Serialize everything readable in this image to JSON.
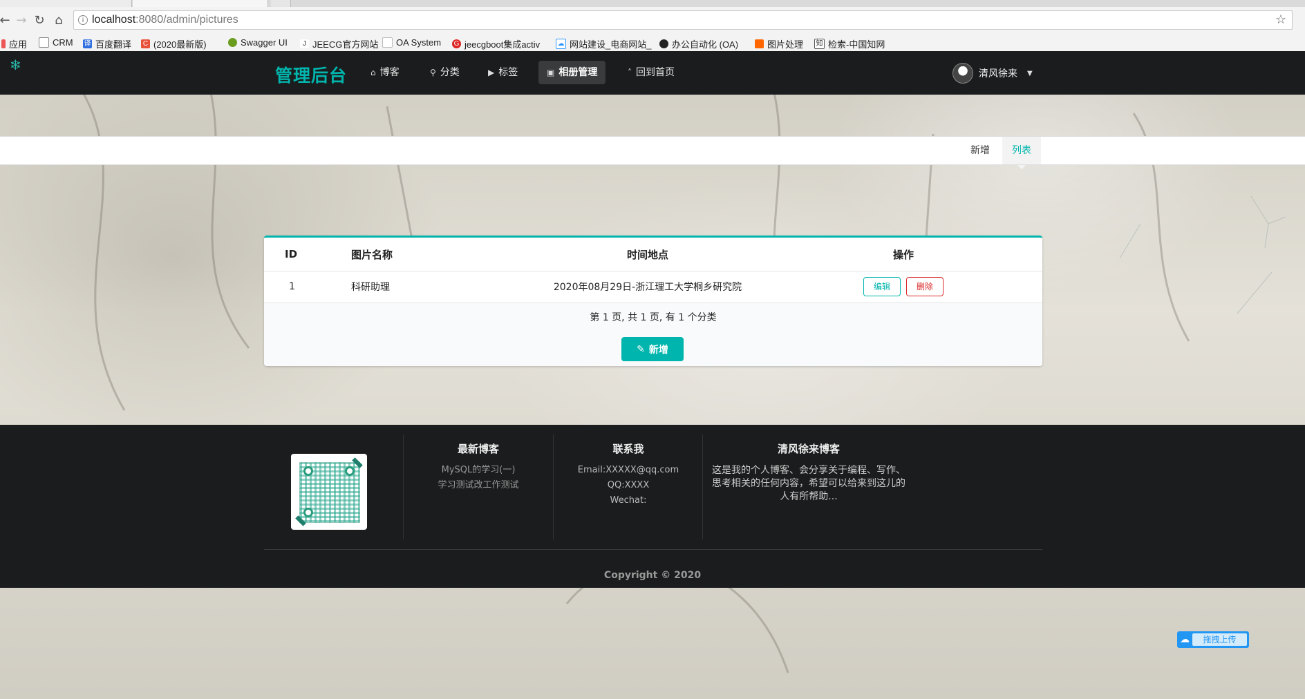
{
  "browser": {
    "url_host": "localhost",
    "url_rest": ":8080/admin/pictures",
    "bookmarks": [
      {
        "label": "应用",
        "icon": "apps-grid-icon"
      },
      {
        "label": "CRM",
        "icon": "page-icon"
      },
      {
        "label": "百度翻译",
        "icon": "baidu-translate-icon"
      },
      {
        "label": "(2020最新版)",
        "icon": "c-red-icon"
      },
      {
        "label": "Swagger UI",
        "icon": "swagger-icon"
      },
      {
        "label": "JEECG官方网站",
        "icon": "jeecg-icon"
      },
      {
        "label": "OA System",
        "icon": "page-icon"
      },
      {
        "label": "jeecgboot集成activ",
        "icon": "g-red-icon"
      },
      {
        "label": "网站建设_电商网站_",
        "icon": "cloud-icon"
      },
      {
        "label": "办公自动化 (OA)",
        "icon": "github-icon"
      },
      {
        "label": "图片处理",
        "icon": "image-orange-icon"
      },
      {
        "label": "检索-中国知网",
        "icon": "cnki-icon"
      }
    ]
  },
  "nav": {
    "brand": "管理后台",
    "items": [
      {
        "label": "博客",
        "icon": "home-icon"
      },
      {
        "label": "分类",
        "icon": "pin-icon"
      },
      {
        "label": "标签",
        "icon": "tags-icon"
      },
      {
        "label": "相册管理",
        "icon": "image-icon",
        "active": true
      },
      {
        "label": "回到首页",
        "icon": "angle-up-icon"
      }
    ],
    "user": "清风徐来"
  },
  "submenu": {
    "add": "新增",
    "list": "列表"
  },
  "table": {
    "headers": {
      "id": "ID",
      "name": "图片名称",
      "time": "时间地点",
      "op": "操作"
    },
    "rows": [
      {
        "id": "1",
        "name": "科研助理",
        "time": "2020年08月29日-浙江理工大学桐乡研究院",
        "edit": "编辑",
        "delete": "删除"
      }
    ],
    "page_info": "第 1 页, 共 1 页, 有 1 个分类",
    "add_button": "新增"
  },
  "footer": {
    "latest_title": "最新博客",
    "latest_items": [
      "MySQL的学习(一)",
      "学习测试改工作测试"
    ],
    "contact_title": "联系我",
    "contact_items": [
      "Email:XXXXX@qq.com",
      "QQ:XXXX",
      "Wechat:"
    ],
    "about_title": "清风徐来博客",
    "about_text": "这是我的个人博客、会分享关于编程、写作、思考相关的任何内容，希望可以给来到这儿的人有所帮助...",
    "copyright": "Copyright © 2020"
  },
  "upload_widget": "拖拽上传",
  "colors": {
    "accent": "#00b5ad",
    "danger": "#db2828",
    "nav_bg": "#1b1c1d"
  }
}
